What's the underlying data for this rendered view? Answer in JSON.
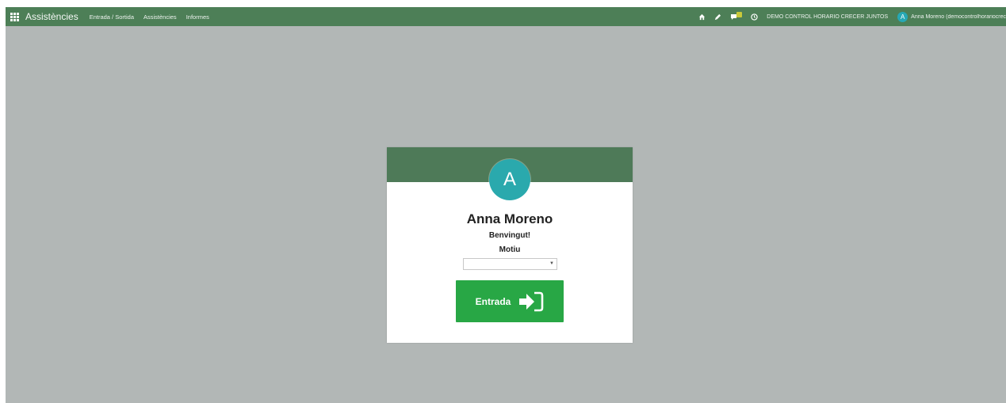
{
  "navbar": {
    "app_title": "Assistències",
    "menu": [
      {
        "label": "Entrada / Sortida"
      },
      {
        "label": "Assistències"
      },
      {
        "label": "Informes"
      }
    ],
    "company": "DEMO CONTROL HORARIO CRECER JUNTOS",
    "user_initial": "A",
    "user_name": "Anna Moreno (democontrolhorariocrec",
    "icons": [
      "apps-grid-icon",
      "home-icon",
      "pencil-icon",
      "chat-icon",
      "clock-icon"
    ]
  },
  "card": {
    "avatar_initial": "A",
    "employee_name": "Anna Moreno",
    "greeting": "Benvingut!",
    "reason_label": "Motiu",
    "reason_value": "",
    "button_label": "Entrada",
    "button_icon": "sign-in-icon"
  },
  "colors": {
    "navbar": "#4d7f57",
    "background": "#b2b7b6",
    "card_header": "#4e7a58",
    "avatar": "#2aa9ad",
    "button": "#28a745"
  }
}
